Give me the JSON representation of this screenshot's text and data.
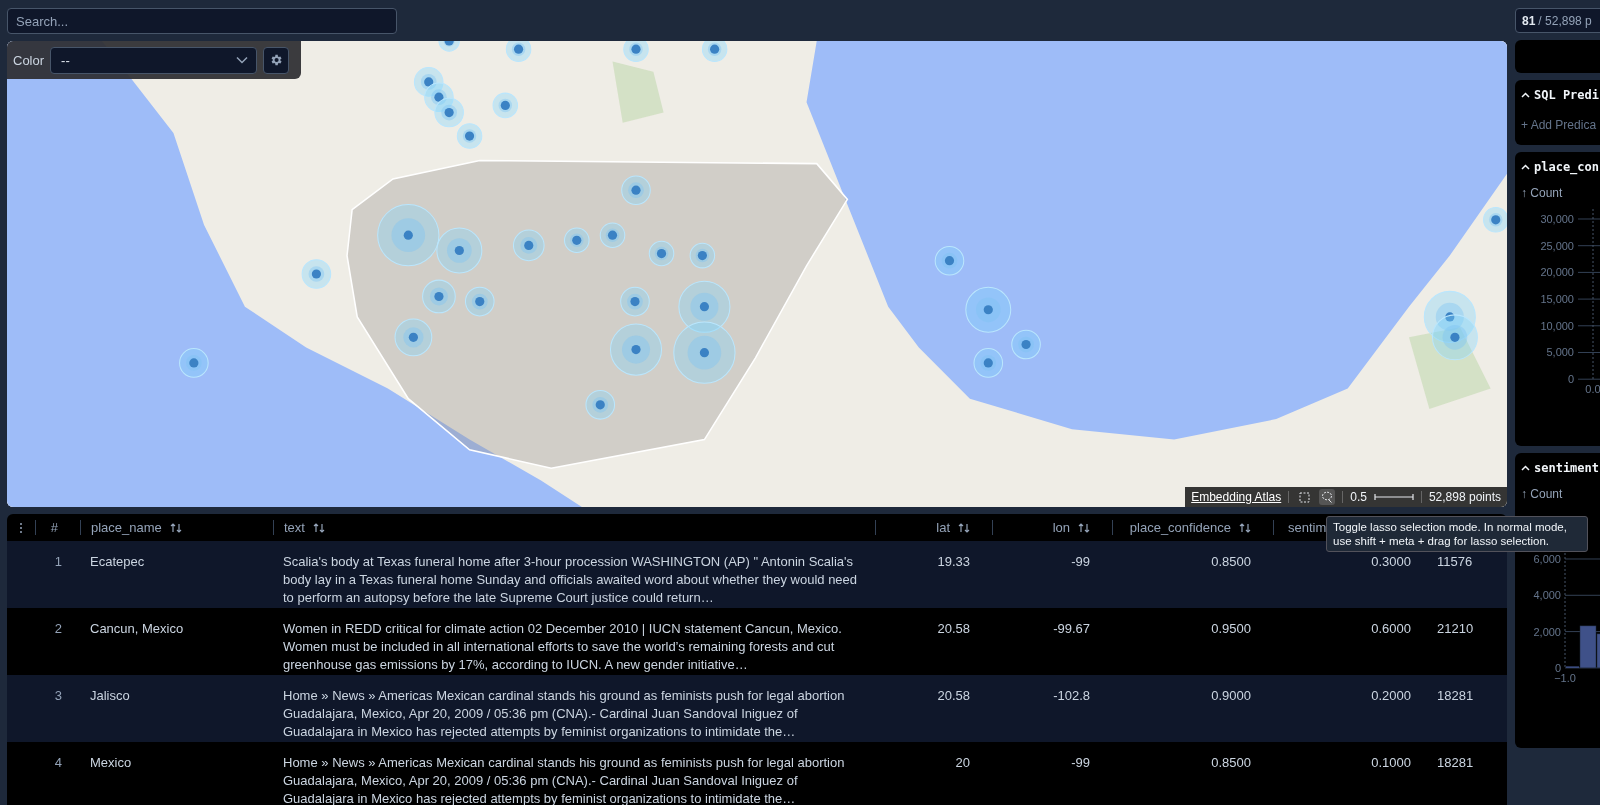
{
  "search": {
    "placeholder": "Search..."
  },
  "selection_count": {
    "selected": "81",
    "total": "/ 52,898 p"
  },
  "map": {
    "color_control": {
      "label": "Color",
      "value": "--"
    },
    "status_bar": {
      "link": "Embedding Atlas",
      "rect_select_active": false,
      "lasso_active": true,
      "point_size": "0.5",
      "points": "52,898 points"
    },
    "tooltip": "Toggle lasso selection mode. In normal mode, use shift + meta + drag for lasso selection."
  },
  "table": {
    "columns": [
      {
        "label": "#",
        "sortable": false
      },
      {
        "label": "place_name",
        "sortable": true
      },
      {
        "label": "text",
        "sortable": true
      },
      {
        "label": "lat",
        "sortable": true
      },
      {
        "label": "lon",
        "sortable": true
      },
      {
        "label": "place_confidence",
        "sortable": true
      },
      {
        "label": "sentim"
      }
    ],
    "rows": [
      {
        "cells": [
          "1",
          "Ecatepec",
          "Scalia's body at Texas funeral home after 3-hour procession WASHINGTON (AP) \" Antonin Scalia's body lay in a Texas funeral home Sunday and officials awaited word about whether they would need to perform an autopsy before the late Supreme Court justice could return…",
          "19.33",
          "-99",
          "0.8500",
          "0.3000",
          "11576"
        ]
      },
      {
        "cells": [
          "2",
          "Cancun, Mexico",
          "Women in REDD critical for climate action 02 December 2010 | IUCN statement Cancun, Mexico. Women must be included in all international efforts to save the world’s remaining forests and cut greenhouse gas emissions by 17%, according to IUCN. A new gender initiative…",
          "20.58",
          "-99.67",
          "0.9500",
          "0.6000",
          "21210"
        ]
      },
      {
        "cells": [
          "3",
          "Jalisco",
          "Home » News » Americas Mexican cardinal stands his ground as feminists push for legal abortion Guadalajara, Mexico, Apr 20, 2009 / 05:36 pm (CNA).- Cardinal Juan Sandoval Iniguez of Guadalajara in Mexico has rejected attempts by feminist organizations to intimidate the…",
          "20.58",
          "-102.8",
          "0.9000",
          "0.2000",
          "18281"
        ]
      },
      {
        "cells": [
          "4",
          "Mexico",
          "Home » News » Americas Mexican cardinal stands his ground as feminists push for legal abortion Guadalajara, Mexico, Apr 20, 2009 / 05:36 pm (CNA).- Cardinal Juan Sandoval Iniguez of Guadalajara in Mexico has rejected attempts by feminist organizations to intimidate the…",
          "20",
          "-99",
          "0.8500",
          "0.1000",
          "18281"
        ]
      }
    ]
  },
  "panels": [
    {
      "kind": "empty"
    },
    {
      "kind": "predicates",
      "title": "SQL Predi",
      "expanded": true,
      "action": "+ Add Predica"
    },
    {
      "kind": "chart",
      "title": "place_con",
      "expanded": true,
      "axis_label": "↑ Count",
      "y_tick_labels": [
        "30,000",
        "25,000",
        "20,000",
        "15,000",
        "10,000",
        "5,000",
        "0"
      ],
      "x_tick_labels": [
        "0.0"
      ]
    },
    {
      "kind": "chart",
      "title": "sentiment",
      "expanded": true,
      "axis_label": "↑ Count",
      "y_tick_labels": [
        "6,000",
        "4,000",
        "2,000",
        "0"
      ],
      "x_tick_labels": [
        "−1.0"
      ]
    }
  ]
}
